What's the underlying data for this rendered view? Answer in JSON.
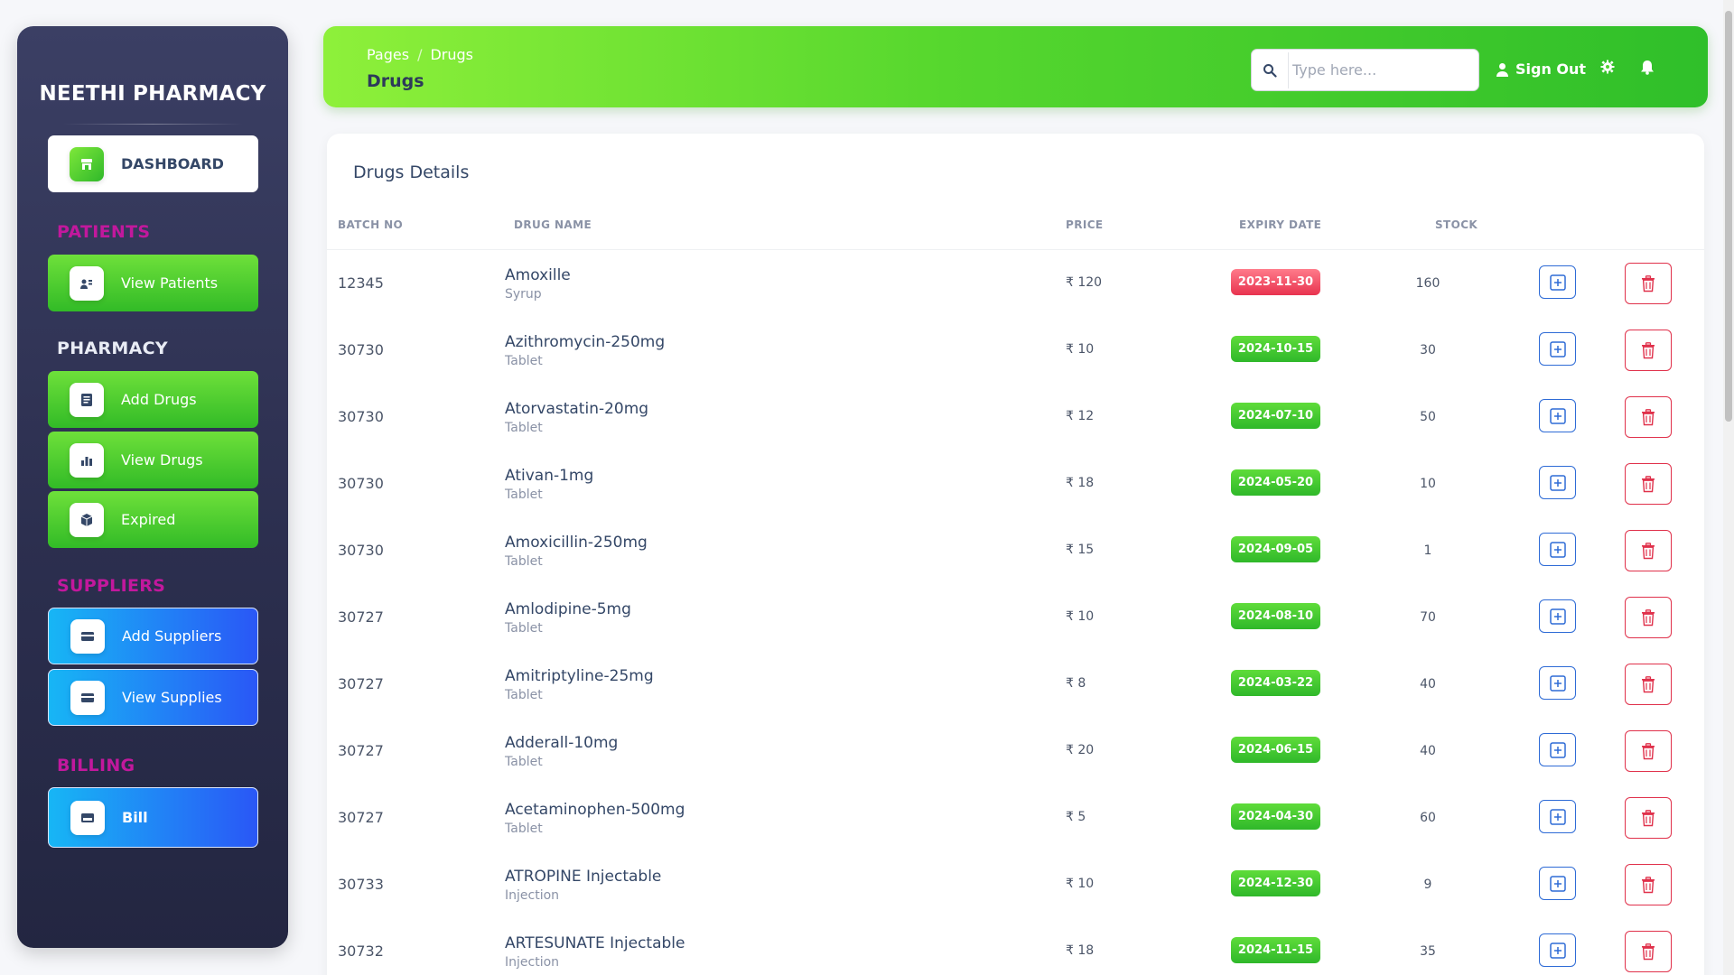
{
  "sidebar": {
    "brand": "NEETHI PHARMACY",
    "dashboard": {
      "label": "DASHBOARD",
      "icon": "store-icon"
    },
    "sections": {
      "patients": {
        "title": "PATIENTS",
        "items": [
          {
            "label": "View Patients",
            "icon": "patients-icon"
          }
        ]
      },
      "pharmacy": {
        "title": "PHARMACY",
        "items": [
          {
            "label": "Add Drugs",
            "icon": "document-icon"
          },
          {
            "label": "View Drugs",
            "icon": "chart-icon"
          },
          {
            "label": "Expired",
            "icon": "box-icon"
          }
        ]
      },
      "suppliers": {
        "title": "SUPPLIERS",
        "items": [
          {
            "label": "Add Suppliers",
            "icon": "card-icon"
          },
          {
            "label": "View Supplies",
            "icon": "card-icon"
          }
        ]
      },
      "billing": {
        "title": "BILLING",
        "items": [
          {
            "label": "Bill",
            "icon": "bill-icon"
          }
        ]
      }
    }
  },
  "header": {
    "breadcrumb": {
      "root": "Pages",
      "separator": "/",
      "current": "Drugs"
    },
    "title": "Drugs",
    "search": {
      "placeholder": "Type here...",
      "value": ""
    },
    "sign_out": "Sign Out"
  },
  "card": {
    "title": "Drugs Details",
    "columns": [
      "BATCH NO",
      "DRUG NAME",
      "PRICE",
      "EXPIRY DATE",
      "STOCK"
    ],
    "rows": [
      {
        "batch": "12345",
        "name": "Amoxille",
        "type": "Syrup",
        "price": "₹ 120",
        "expiry": "2023-11-30",
        "expired": true,
        "stock": "160"
      },
      {
        "batch": "30730",
        "name": "Azithromycin-250mg",
        "type": "Tablet",
        "price": "₹ 10",
        "expiry": "2024-10-15",
        "expired": false,
        "stock": "30"
      },
      {
        "batch": "30730",
        "name": "Atorvastatin-20mg",
        "type": "Tablet",
        "price": "₹ 12",
        "expiry": "2024-07-10",
        "expired": false,
        "stock": "50"
      },
      {
        "batch": "30730",
        "name": "Ativan-1mg",
        "type": "Tablet",
        "price": "₹ 18",
        "expiry": "2024-05-20",
        "expired": false,
        "stock": "10"
      },
      {
        "batch": "30730",
        "name": "Amoxicillin-250mg",
        "type": "Tablet",
        "price": "₹ 15",
        "expiry": "2024-09-05",
        "expired": false,
        "stock": "1"
      },
      {
        "batch": "30727",
        "name": "Amlodipine-5mg",
        "type": "Tablet",
        "price": "₹ 10",
        "expiry": "2024-08-10",
        "expired": false,
        "stock": "70"
      },
      {
        "batch": "30727",
        "name": "Amitriptyline-25mg",
        "type": "Tablet",
        "price": "₹ 8",
        "expiry": "2024-03-22",
        "expired": false,
        "stock": "40"
      },
      {
        "batch": "30727",
        "name": "Adderall-10mg",
        "type": "Tablet",
        "price": "₹ 20",
        "expiry": "2024-06-15",
        "expired": false,
        "stock": "40"
      },
      {
        "batch": "30727",
        "name": "Acetaminophen-500mg",
        "type": "Tablet",
        "price": "₹ 5",
        "expiry": "2024-04-30",
        "expired": false,
        "stock": "60"
      },
      {
        "batch": "30733",
        "name": "ATROPINE Injectable",
        "type": "Injection",
        "price": "₹ 10",
        "expiry": "2024-12-30",
        "expired": false,
        "stock": "9"
      },
      {
        "batch": "30732",
        "name": "ARTESUNATE Injectable",
        "type": "Injection",
        "price": "₹ 18",
        "expiry": "2024-11-15",
        "expired": false,
        "stock": "35"
      }
    ]
  },
  "colors": {
    "accent_green": "#56d72e",
    "accent_blue": "#2a57f6",
    "sidebar_bg": "#2c2f4f",
    "section_pink": "#c2189d",
    "expired_red": "#e8334f",
    "delete_red": "#e0314b",
    "edit_blue": "#2e6bd6"
  }
}
